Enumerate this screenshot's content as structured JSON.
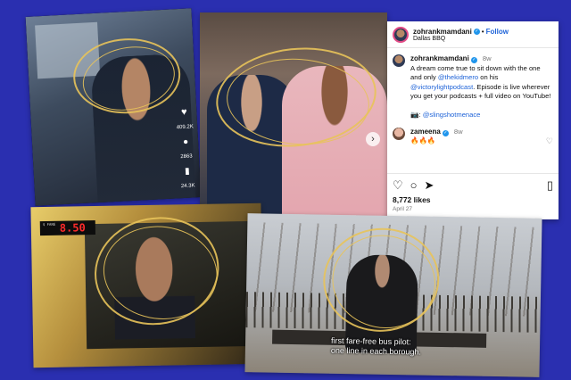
{
  "tiktok": {
    "likes": "409.2K",
    "comments": "2863",
    "bookmarks": "24.3K"
  },
  "instagram": {
    "author": "zohrankmamdani",
    "location": "Dallas BBQ",
    "follow_label": "Follow",
    "dot": "•",
    "caption_author": "zohrankmamdani",
    "caption_time": "8w",
    "caption_part1": "A dream come true to sit down with the one and only ",
    "mention1": "@thekidmero",
    "caption_part2": " on his ",
    "mention2": "@victorylightpodcast",
    "caption_part3": ". Episode is live wherever you get your podcasts + full video on YouTube!",
    "camera_emoji": "📷:",
    "mention3": "@slingshotmenace",
    "comment_author": "zameena",
    "comment_time": "8w",
    "comment_text": "🔥🔥🔥",
    "likes": "8,772 likes",
    "date": "April 27"
  },
  "taxi": {
    "meter_label": "$ FARE",
    "meter_value": "8.50"
  },
  "bench": {
    "caption_line1": "first fare-free bus pilot:",
    "caption_line2": "one line in each borough."
  },
  "colors": {
    "background": "#2a2fb0",
    "accent_ring": "#e8c35a",
    "link": "#1e63d8"
  }
}
